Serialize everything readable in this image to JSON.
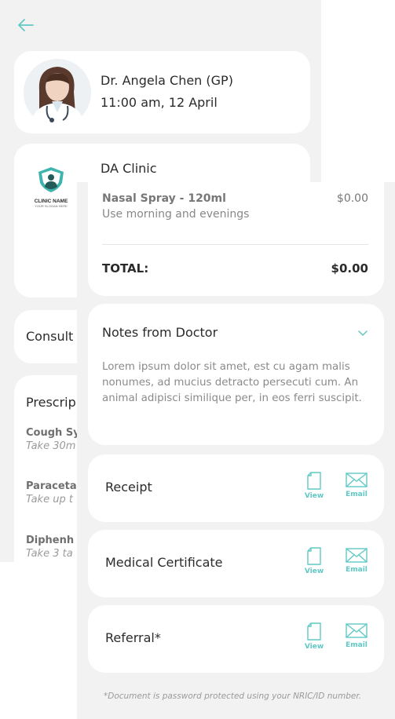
{
  "colors": {
    "accent": "#5fc9c4",
    "background": "#f2f2f2",
    "card": "#ffffff"
  },
  "header": {
    "back_icon": "arrow-left-icon"
  },
  "appointment": {
    "doctor_name": "Dr. Angela Chen (GP)",
    "datetime": "11:00 am, 12 April"
  },
  "clinic": {
    "name": "DA Clinic",
    "logo_text": "CLINIC NAME",
    "logo_slogan": "YOUR SLOGAN HERE"
  },
  "consultation": {
    "label": "Consult"
  },
  "prescription": {
    "title": "Prescrip",
    "items": [
      {
        "name": "Cough Sy",
        "dosage": "Take 30m"
      },
      {
        "name": "Paraceta",
        "dosage": "Take up t"
      },
      {
        "name": "Diphenh",
        "dosage": "Take 3 ta"
      }
    ]
  },
  "order": {
    "item_name": "Nasal Spray - 120ml",
    "item_note": "Use morning and evenings",
    "item_price": "$0.00",
    "total_label": "TOTAL:",
    "total_value": "$0.00"
  },
  "notes": {
    "title": "Notes from Doctor",
    "body": "Lorem ipsum dolor sit amet, est cu agam malis nonumes, ad mucius detracto persecuti cum. An animal adipisci similique per, in eos ferri suscipit."
  },
  "documents": [
    {
      "label": "Receipt",
      "view_label": "View",
      "email_label": "Email"
    },
    {
      "label": "Medical Certificate",
      "view_label": "View",
      "email_label": "Email"
    },
    {
      "label": "Referral*",
      "view_label": "View",
      "email_label": "Email"
    }
  ],
  "footnote": "*Document is password protected using your NRIC/ID number."
}
